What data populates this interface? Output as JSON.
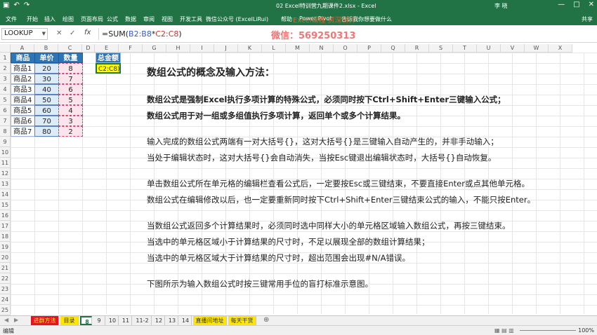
{
  "titlebar": {
    "save_icon": "save-icon",
    "window_title": "02 Excel特训营九期课件2.xlsx  -  Excel",
    "user": "李 晓",
    "minimize": "—",
    "restore": "□",
    "close": "✕"
  },
  "watermarks": {
    "top": "Excel课程 资深讲师",
    "wechat": "微信：569250313"
  },
  "ribbon_tabs": [
    "文件",
    "开始",
    "插入",
    "绘图",
    "页面布局",
    "公式",
    "数据",
    "审阅",
    "视图",
    "开发工具",
    "微信公众号 (ExcelLiRui)",
    "帮助",
    "Power Pivot",
    "告诉我你想要做什么"
  ],
  "share_label": "共享",
  "formula_bar": {
    "name_box": "LOOKUP",
    "cancel": "✕",
    "enter": "✓",
    "fx": "fx",
    "formula_prefix": "=SUM(",
    "formula_ref1": "B2:B8",
    "formula_mid": "*",
    "formula_ref2": "C2:C8",
    "formula_suffix": ")"
  },
  "columns": [
    "A",
    "B",
    "C",
    "D",
    "E",
    "F",
    "G",
    "H",
    "I",
    "J",
    "K",
    "L",
    "M",
    "N",
    "O",
    "P",
    "Q",
    "R",
    "S",
    "T",
    "U",
    "V",
    "W",
    "X"
  ],
  "rows": [
    "1",
    "2",
    "3",
    "4",
    "5",
    "6",
    "7",
    "8",
    "9",
    "10",
    "11",
    "12",
    "13",
    "14",
    "15",
    "16",
    "17",
    "18",
    "19",
    "20",
    "21",
    "22",
    "23",
    "24",
    "25"
  ],
  "table": {
    "headers": [
      "商品",
      "单价",
      "数量"
    ],
    "rows": [
      [
        "商品1",
        "20",
        "8"
      ],
      [
        "商品2",
        "30",
        "7"
      ],
      [
        "商品3",
        "40",
        "6"
      ],
      [
        "商品4",
        "50",
        "5"
      ],
      [
        "商品5",
        "60",
        "4"
      ],
      [
        "商品6",
        "70",
        "3"
      ],
      [
        "商品7",
        "80",
        "2"
      ]
    ],
    "total_header": "总金额",
    "active_cell": "C2:C8)"
  },
  "content": {
    "heading": "数组公式的概念及输入方法：",
    "p1": "数组公式是强制Excel执行多项计算的特殊公式，必须同时按下Ctrl+Shift+Enter三键输入公式；",
    "p2": "数组公式用于对一组或多组值执行多项计算，返回单个或多个计算结果。",
    "p3": "输入完成的数组公式两端有一对大括号{}，这对大括号{}是三键输入自动产生的，并非手动输入；",
    "p4": "当处于编辑状态时，这对大括号{}会自动消失，当按Esc键退出编辑状态时，大括号{}自动恢复。",
    "p5": "单击数组公式所在单元格的编辑栏查看公式后，一定要按Esc或三键结束，不要直接Enter或点其他单元格。",
    "p6": "数组公式在编辑修改以后，也一定要重新同时按下Ctrl+Shift+Enter三键结束公式的输入，不能只按Enter。",
    "p7": "当数组公式返回多个计算结果时，必须同时选中同样大小的单元格区域输入数组公式，再按三键结束。",
    "p8": "当选中的单元格区域小于计算结果的尺寸时，不足以展现全部的数组计算结果；",
    "p9": "当选中的单元格区域大于计算结果的尺寸时，超出范围会出现#N/A错误。",
    "p10": "下图所示为输入数组公式时按三键常用手位的盲打标准示意图。"
  },
  "sheet_tabs": [
    {
      "label": "进群方法",
      "style": "red"
    },
    {
      "label": "目录",
      "style": "yellow"
    },
    {
      "label": "8",
      "style": "active"
    },
    {
      "label": "9",
      "style": ""
    },
    {
      "label": "10",
      "style": ""
    },
    {
      "label": "11",
      "style": ""
    },
    {
      "label": "11-2",
      "style": ""
    },
    {
      "label": "12",
      "style": ""
    },
    {
      "label": "13",
      "style": ""
    },
    {
      "label": "14",
      "style": ""
    },
    {
      "label": "直播间地址",
      "style": "yellow"
    },
    {
      "label": "每天干货",
      "style": "yellow"
    }
  ],
  "add_sheet": "⊕",
  "status": {
    "mode": "编辑",
    "zoom": "100%"
  },
  "colors": {
    "excel_green": "#217346",
    "header_blue": "#2e75b6",
    "active_yellow": "#ffff00"
  }
}
